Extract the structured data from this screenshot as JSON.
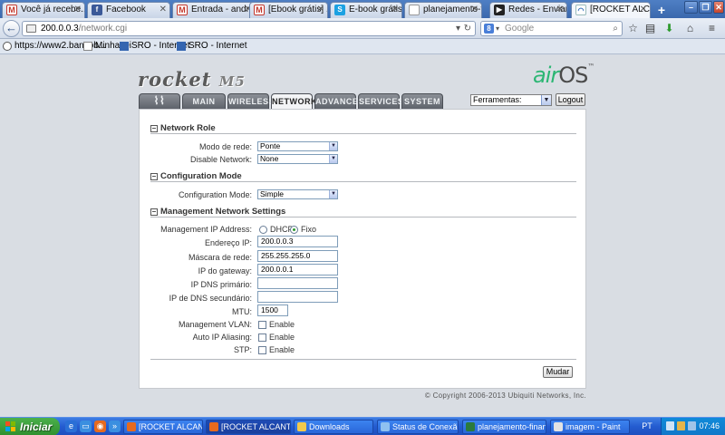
{
  "browser": {
    "tabs": [
      {
        "label": "Você já recebe...",
        "icon": "gmail-icon",
        "active": false
      },
      {
        "label": "Facebook",
        "icon": "facebook-icon",
        "active": false
      },
      {
        "label": "Entrada - andr...",
        "icon": "gmail-icon",
        "active": false
      },
      {
        "label": "[Ebook grátis] ...",
        "icon": "gmail-icon",
        "active": false
      },
      {
        "label": "E-book grátis | ...",
        "icon": "skype-icon",
        "active": false
      },
      {
        "label": "planejamento-finan...",
        "icon": "blank-page-icon",
        "active": false
      },
      {
        "label": "Redes - Enviar ...",
        "icon": "arrow-icon",
        "active": false
      },
      {
        "label": "[ROCKET ALCA...",
        "icon": "wifi-icon",
        "active": true
      }
    ],
    "new_tab": "+",
    "url_host": "200.0.0.3",
    "url_path": "/network.cgi",
    "search_placeholder": "Google",
    "bookmarks": [
      {
        "label": "https://www2.bancob...",
        "icon": "link-icon"
      },
      {
        "label": "Minha Oi",
        "icon": "page-icon"
      },
      {
        "label": "SRO - Internet",
        "icon": "sro-icon"
      },
      {
        "label": "SRO - Internet",
        "icon": "sro-icon"
      }
    ]
  },
  "header": {
    "brand": "rocket",
    "model": "M5",
    "os_air": "air",
    "os_name": "OS",
    "os_tm": "™",
    "tabs": [
      {
        "label": "",
        "icon": "ubiquiti-logo-icon"
      },
      {
        "label": "MAIN"
      },
      {
        "label": "WIRELESS"
      },
      {
        "label": "NETWORK",
        "active": true
      },
      {
        "label": "ADVANCED"
      },
      {
        "label": "SERVICES"
      },
      {
        "label": "SYSTEM"
      }
    ],
    "tools_select": "Ferramentas:",
    "logout": "Logout"
  },
  "form": {
    "network_role": {
      "title": "Network Role",
      "mode_label": "Modo de rede:",
      "mode_value": "Ponte",
      "disable_label": "Disable Network:",
      "disable_value": "None"
    },
    "configuration_mode": {
      "title": "Configuration Mode",
      "label": "Configuration Mode:",
      "value": "Simple"
    },
    "management": {
      "title": "Management Network Settings",
      "ip_address_label": "Management IP Address:",
      "dhcp_label": "DHCP",
      "fixed_label": "Fixo",
      "selected": "Fixo",
      "ip_label": "Endereço IP:",
      "ip_value": "200.0.0.3",
      "mask_label": "Máscara de rede:",
      "mask_value": "255.255.255.0",
      "gateway_label": "IP do gateway:",
      "gateway_value": "200.0.0.1",
      "dns1_label": "IP DNS primário:",
      "dns1_value": "",
      "dns2_label": "IP de DNS secundário:",
      "dns2_value": "",
      "mtu_label": "MTU:",
      "mtu_value": "1500",
      "vlan_label": "Management VLAN:",
      "alias_label": "Auto IP Aliasing:",
      "stp_label": "STP:",
      "enable_label": "Enable"
    },
    "apply": "Mudar"
  },
  "footer": {
    "copyright": "© Copyright 2006-2013 Ubiquiti Networks, Inc."
  },
  "taskbar": {
    "start": "Iniciar",
    "tasks": [
      {
        "label": "[ROCKET ALCANTIL...",
        "icon": "firefox-icon",
        "active": false
      },
      {
        "label": "[ROCKET ALCANTIL...",
        "icon": "firefox-icon",
        "active": true
      },
      {
        "label": "Downloads",
        "icon": "folder-icon",
        "active": false
      },
      {
        "label": "Status de Conexão ...",
        "icon": "network-icon",
        "active": false
      },
      {
        "label": "planejamento-finan...",
        "icon": "document-icon",
        "active": false
      },
      {
        "label": "imagem - Paint",
        "icon": "paint-icon",
        "active": false
      }
    ],
    "lang": "PT",
    "clock": "07:46"
  }
}
